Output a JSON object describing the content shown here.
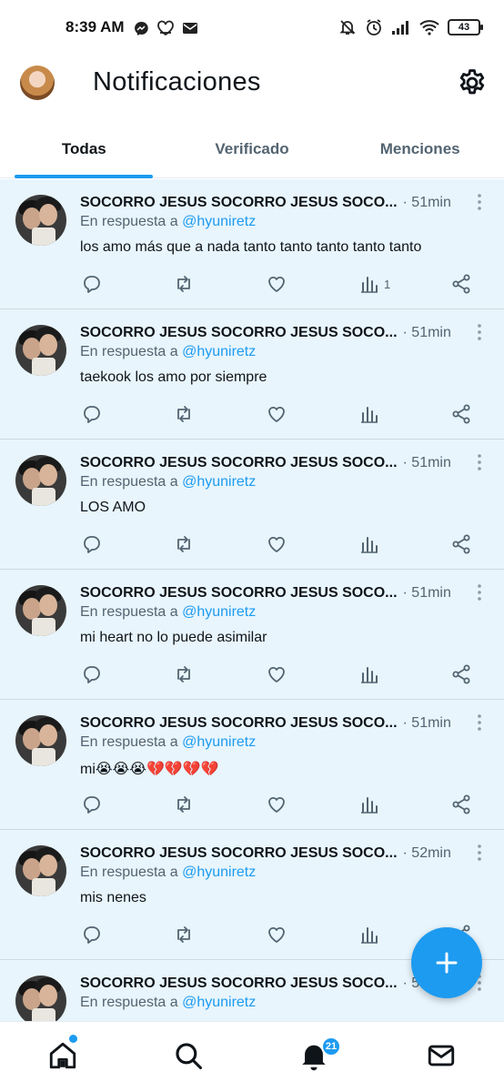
{
  "status_bar": {
    "time": "8:39 AM",
    "battery": "43"
  },
  "header": {
    "title": "Notificaciones"
  },
  "tabs": [
    {
      "label": "Todas",
      "active": true
    },
    {
      "label": "Verificado",
      "active": false
    },
    {
      "label": "Menciones",
      "active": false
    }
  ],
  "colors": {
    "accent": "#1d9bf0",
    "unread_bg": "#e8f5fd",
    "muted": "#536471"
  },
  "tweets": [
    {
      "name": "SOCORRO JESUS SOCORRO JESUS SOCO...",
      "time": "· 51min",
      "reply_prefix": "En respuesta a",
      "mention": "@hyuniretz",
      "text": "los amo más que a nada tanto tanto tanto tanto tanto",
      "views": "1"
    },
    {
      "name": "SOCORRO JESUS SOCORRO JESUS SOCO...",
      "time": "· 51min",
      "reply_prefix": "En respuesta a",
      "mention": "@hyuniretz",
      "text": "taekook los amo por siempre",
      "views": ""
    },
    {
      "name": "SOCORRO JESUS SOCORRO JESUS SOCO...",
      "time": "· 51min",
      "reply_prefix": "En respuesta a",
      "mention": "@hyuniretz",
      "text": "LOS AMO",
      "views": ""
    },
    {
      "name": "SOCORRO JESUS SOCORRO JESUS SOCO...",
      "time": "· 51min",
      "reply_prefix": "En respuesta a",
      "mention": "@hyuniretz",
      "text": "mi heart no lo puede asimilar",
      "views": ""
    },
    {
      "name": "SOCORRO JESUS SOCORRO JESUS SOCO...",
      "time": "· 51min",
      "reply_prefix": "En respuesta a",
      "mention": "@hyuniretz",
      "text": "mi😭😭😭💔💔💔💔",
      "views": ""
    },
    {
      "name": "SOCORRO JESUS SOCORRO JESUS SOCO...",
      "time": "· 52min",
      "reply_prefix": "En respuesta a",
      "mention": "@hyuniretz",
      "text": "mis nenes",
      "views": ""
    },
    {
      "name": "SOCORRO JESUS SOCORRO JESUS SOCO...",
      "time": "· 5",
      "reply_prefix": "En respuesta a",
      "mention": "@hyuniretz",
      "text": "",
      "views": ""
    }
  ],
  "bottom_nav": {
    "items": [
      "home-icon",
      "search-icon",
      "bell-icon",
      "mail-icon"
    ],
    "notifications_badge": "21"
  }
}
